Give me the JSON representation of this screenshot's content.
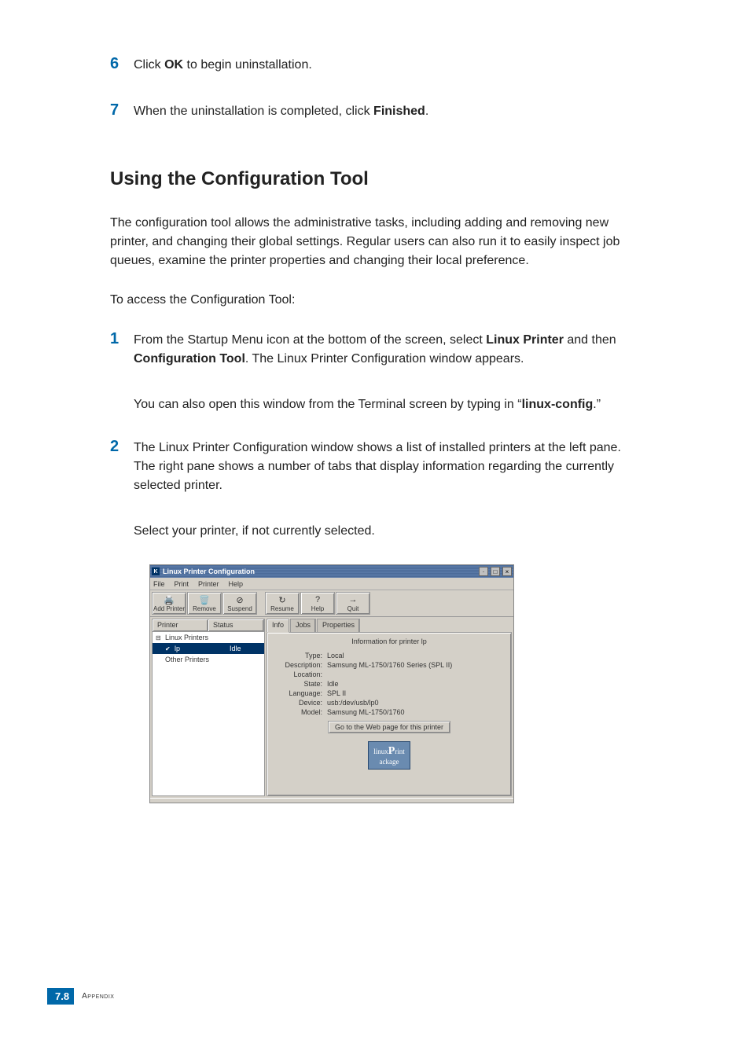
{
  "steps_top": [
    {
      "num": "6",
      "parts": [
        "Click ",
        {
          "b": "OK"
        },
        " to begin uninstallation."
      ]
    },
    {
      "num": "7",
      "parts": [
        "When the uninstallation is completed, click ",
        {
          "b": "Finished"
        },
        "."
      ]
    }
  ],
  "heading": "Using the Configuration Tool",
  "intro": "The configuration tool allows the administrative tasks, including adding and removing new printer, and changing their global settings. Regular users can also run it to easily inspect job queues, examine the printer properties and changing their local preference.",
  "access_line": "To access the Configuration Tool:",
  "steps_bottom": [
    {
      "num": "1",
      "parts": [
        "From the Startup Menu icon at the bottom of the screen, select ",
        {
          "b": "Linux Printer"
        },
        " and then ",
        {
          "b": "Configuration Tool"
        },
        ". The Linux Printer Configuration window appears."
      ],
      "sub": [
        "You can also open this window from the Terminal screen by typing in “",
        {
          "b": "linux-config"
        },
        ".”"
      ]
    },
    {
      "num": "2",
      "parts": [
        "The Linux Printer Configuration window shows a list of installed printers at the left pane. The right pane shows a number of tabs that display information regarding the currently selected printer."
      ],
      "sub": [
        "Select your printer, if not currently selected."
      ]
    }
  ],
  "window": {
    "title": "Linux Printer Configuration",
    "menus": [
      "File",
      "Print",
      "Printer",
      "Help"
    ],
    "toolbar": [
      {
        "label": "Add Printer",
        "icon": "🖨️"
      },
      {
        "label": "Remove",
        "icon": "🗑️"
      },
      {
        "label": "Suspend",
        "icon": "⊘"
      },
      {
        "sep": true
      },
      {
        "label": "Resume",
        "icon": "↻"
      },
      {
        "label": "Help",
        "icon": "?"
      },
      {
        "label": "Quit",
        "icon": "→"
      }
    ],
    "tree": {
      "headers": [
        "Printer",
        "Status"
      ],
      "rows": [
        {
          "indent": 0,
          "icon": "⊟",
          "label": "Linux Printers",
          "status": ""
        },
        {
          "indent": 1,
          "icon": "✔",
          "label": "lp",
          "status": "Idle",
          "sel": true
        },
        {
          "indent": 0,
          "icon": "",
          "label": "Other Printers",
          "status": ""
        }
      ]
    },
    "tabs": [
      "Info",
      "Jobs",
      "Properties"
    ],
    "active_tab": 0,
    "info": {
      "heading": "Information for printer lp",
      "rows": [
        {
          "label": "Type:",
          "value": "Local"
        },
        {
          "label": "Description:",
          "value": "Samsung ML-1750/1760 Series (SPL II)"
        },
        {
          "label": "Location:",
          "value": ""
        },
        {
          "label": "State:",
          "value": "Idle"
        },
        {
          "label": "Language:",
          "value": "SPL II"
        },
        {
          "label": "Device:",
          "value": "usb:/dev/usb/lp0"
        },
        {
          "label": "Model:",
          "value": "Samsung ML-1750/1760"
        }
      ],
      "web_button": "Go to the Web page for this printer",
      "logo": {
        "pre": "linux",
        "mid": "P",
        "suf": "rint\nackage"
      }
    }
  },
  "footer": {
    "chapter": "7.",
    "page": "8",
    "label": "Appendix"
  }
}
